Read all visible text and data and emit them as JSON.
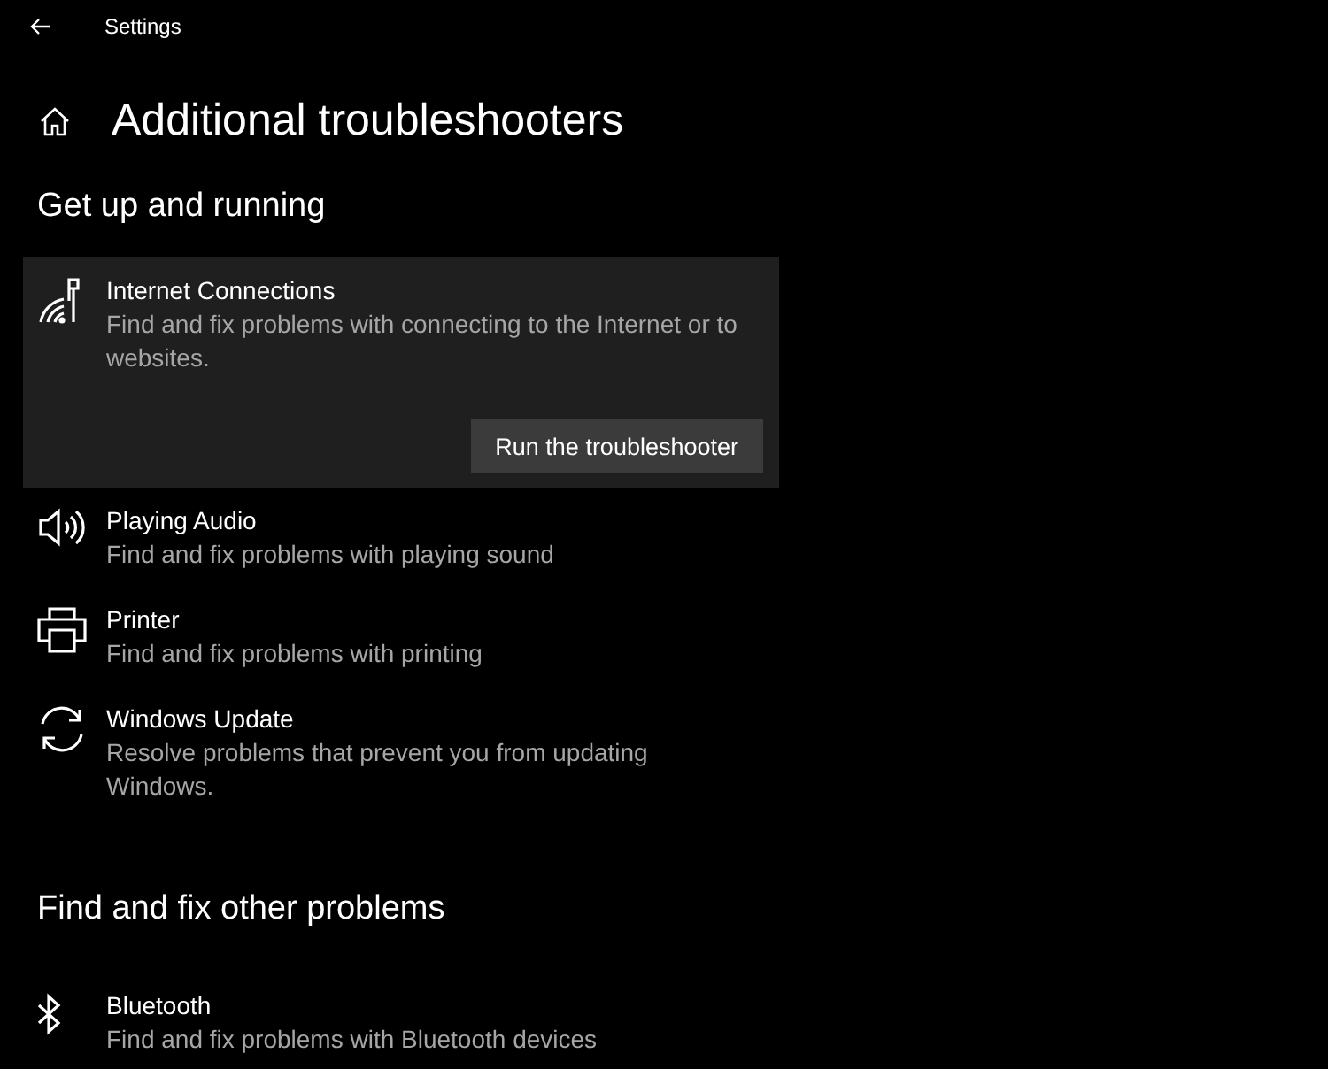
{
  "window": {
    "title": "Settings"
  },
  "page_title": "Additional troubleshooters",
  "sections": [
    {
      "heading": "Get up and running",
      "items": [
        {
          "kind": "wifi",
          "title": "Internet Connections",
          "description": "Find and fix problems with connecting to the Internet or to websites.",
          "selected": true,
          "action": "Run the troubleshooter"
        },
        {
          "kind": "audio",
          "title": "Playing Audio",
          "description": "Find and fix problems with playing sound",
          "selected": false
        },
        {
          "kind": "printer",
          "title": "Printer",
          "description": "Find and fix problems with printing",
          "selected": false
        },
        {
          "kind": "update",
          "title": "Windows Update",
          "description": "Resolve problems that prevent you from updating Windows.",
          "selected": false
        }
      ]
    },
    {
      "heading": "Find and fix other problems",
      "items": [
        {
          "kind": "bluetooth",
          "title": "Bluetooth",
          "description": "Find and fix problems with Bluetooth devices",
          "selected": false
        }
      ]
    }
  ]
}
